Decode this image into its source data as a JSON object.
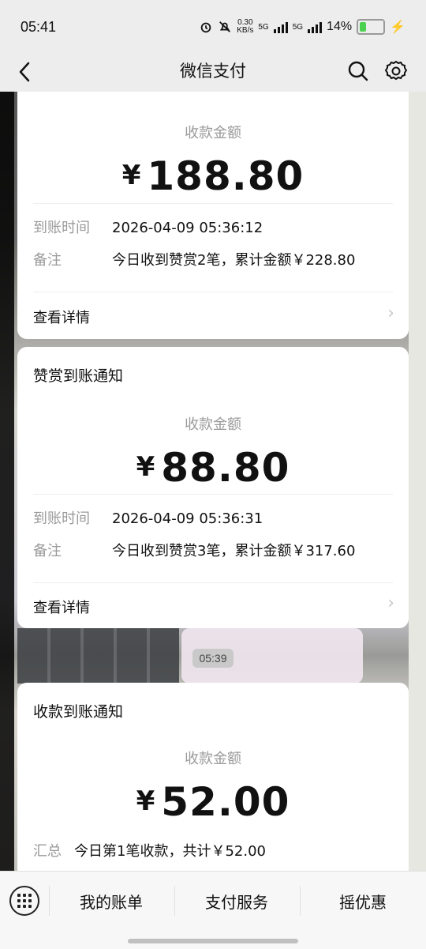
{
  "status": {
    "time": "05:41",
    "speed_top": "0.30",
    "speed_unit": "KB/s",
    "net1": "5G",
    "net2": "5G",
    "battery": "14%"
  },
  "header": {
    "title": "微信支付"
  },
  "cards": [
    {
      "amount_label": "收款金额",
      "currency": "¥",
      "amount": "188.80",
      "rows": [
        {
          "key": "到账时间",
          "value": "2026-04-09 05:36:12"
        },
        {
          "key": "备注",
          "value": "今日收到赞赏2笔，累计金额￥228.80"
        }
      ],
      "detail": "查看详情"
    },
    {
      "title": "赞赏到账通知",
      "amount_label": "收款金额",
      "currency": "¥",
      "amount": "88.80",
      "rows": [
        {
          "key": "到账时间",
          "value": "2026-04-09 05:36:31"
        },
        {
          "key": "备注",
          "value": "今日收到赞赏3笔，累计金额￥317.60"
        }
      ],
      "detail": "查看详情"
    },
    {
      "title": "收款到账通知",
      "amount_label": "收款金额",
      "currency": "¥",
      "amount": "52.00",
      "rows": [
        {
          "key": "汇总",
          "value": "今日第1笔收款，共计￥52.00"
        }
      ]
    }
  ],
  "timestamp": "05:39",
  "bottom_menu": [
    "我的账单",
    "支付服务",
    "摇优惠"
  ]
}
